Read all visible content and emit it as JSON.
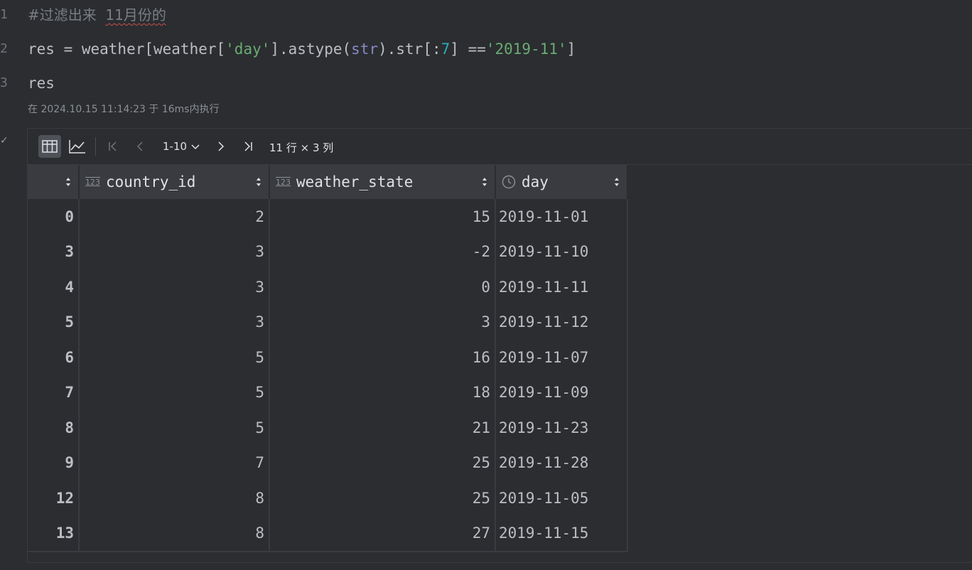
{
  "line_numbers": [
    "1",
    "2",
    "3"
  ],
  "code": {
    "line1_hash": "#",
    "line1_comment": "过滤出来",
    "line1_comment2": "11月份的",
    "line2_a": "res = weather[weather[",
    "line2_str1": "'day'",
    "line2_b": "].astype(",
    "line2_builtin": "str",
    "line2_c": ").str[:",
    "line2_num": "7",
    "line2_d": "] ==",
    "line2_str2": "'2019-11'",
    "line2_e": "]",
    "line3": "res"
  },
  "exec_info": "在 2024.10.15 11:14:23 于 16ms内执行",
  "toolbar": {
    "page_range": "1-10",
    "shape": "11 行 × 3 列"
  },
  "table": {
    "columns": [
      {
        "name": "country_id",
        "type_icon": "123"
      },
      {
        "name": "weather_state",
        "type_icon": "123"
      },
      {
        "name": "day",
        "type_icon": "clock-icon"
      }
    ],
    "rows": [
      {
        "index": "0",
        "country_id": "2",
        "weather_state": "15",
        "day": "2019-11-01"
      },
      {
        "index": "3",
        "country_id": "3",
        "weather_state": "-2",
        "day": "2019-11-10"
      },
      {
        "index": "4",
        "country_id": "3",
        "weather_state": "0",
        "day": "2019-11-11"
      },
      {
        "index": "5",
        "country_id": "3",
        "weather_state": "3",
        "day": "2019-11-12"
      },
      {
        "index": "6",
        "country_id": "5",
        "weather_state": "16",
        "day": "2019-11-07"
      },
      {
        "index": "7",
        "country_id": "5",
        "weather_state": "18",
        "day": "2019-11-09"
      },
      {
        "index": "8",
        "country_id": "5",
        "weather_state": "21",
        "day": "2019-11-23"
      },
      {
        "index": "9",
        "country_id": "7",
        "weather_state": "25",
        "day": "2019-11-28"
      },
      {
        "index": "12",
        "country_id": "8",
        "weather_state": "25",
        "day": "2019-11-05"
      },
      {
        "index": "13",
        "country_id": "8",
        "weather_state": "27",
        "day": "2019-11-15"
      }
    ]
  },
  "colors": {
    "background": "#2b2d30",
    "string": "#6aab73",
    "number": "#2aacb8",
    "builtin": "#8888c6",
    "comment": "#7a7e85"
  }
}
